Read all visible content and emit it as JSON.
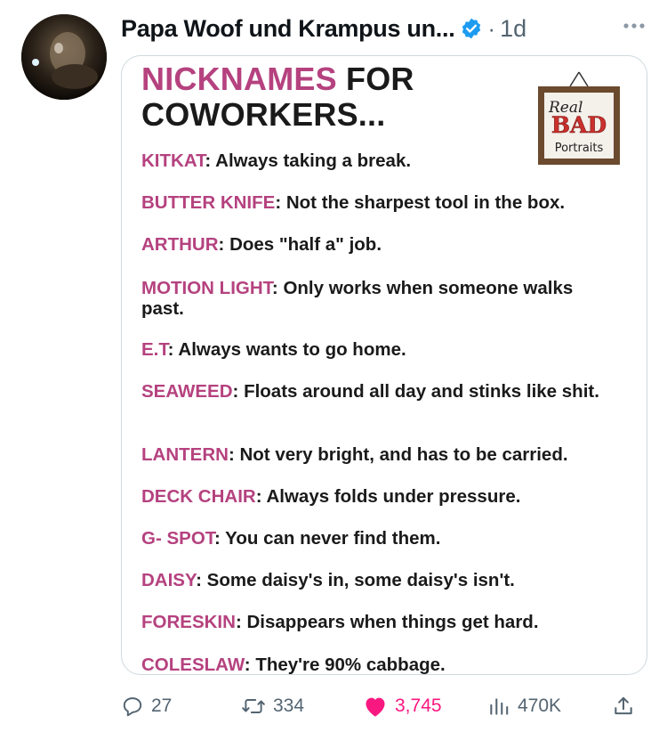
{
  "post": {
    "author": "Papa Woof und Krampus un...",
    "dot": "·",
    "time": "1d"
  },
  "meme": {
    "title_line1_pink": "NICKNAMES",
    "title_line1_rest": " FOR",
    "title_line2": "COWORKERS...",
    "frame": {
      "line1": "Real",
      "line2": "BAD",
      "line3": "Portraits"
    },
    "items": [
      {
        "term": "KITKAT",
        "sep": ": ",
        "def": "Always taking a break."
      },
      {
        "term": "BUTTER KNIFE",
        "sep": ": ",
        "def": "Not the sharpest tool in the box."
      },
      {
        "term": "ARTHUR",
        "sep": ": ",
        "def": "Does \"half a\" job."
      },
      {
        "term": "MOTION LIGHT",
        "sep": ": ",
        "def": "Only works when someone walks past."
      },
      {
        "term": "E.T",
        "sep": ": ",
        "def": "Always wants to go home."
      },
      {
        "term": "SEAWEED",
        "sep": ": ",
        "def": "Floats around all day and stinks like shit."
      },
      {
        "term": "LANTERN",
        "sep": ": ",
        "def": "Not very bright, and has to be carried."
      },
      {
        "term": "DECK CHAIR",
        "sep": ": ",
        "def": "Always folds under pressure."
      },
      {
        "term": "G- SPOT",
        "sep": ": ",
        "def": "You can never find them."
      },
      {
        "term": "DAISY",
        "sep": ": ",
        "def": "Some daisy's in, some daisy's isn't."
      },
      {
        "term": "FORESKIN",
        "sep": ": ",
        "def": "Disappears when things get hard."
      },
      {
        "term": "COLESLAW",
        "sep": ": ",
        "def": "They're 90% cabbage."
      }
    ]
  },
  "actions": {
    "replies": "27",
    "reposts": "334",
    "likes": "3,745",
    "views": "470K"
  },
  "colors": {
    "accent_pink": "#b5427f",
    "like_pink": "#f91880",
    "verified_blue": "#1d9bf0",
    "muted": "#536471"
  },
  "icons": [
    "avatar",
    "verified-badge-icon",
    "more-icon",
    "picture-frame-icon",
    "reply-icon",
    "repost-icon",
    "like-heart-icon",
    "views-icon",
    "share-icon"
  ]
}
